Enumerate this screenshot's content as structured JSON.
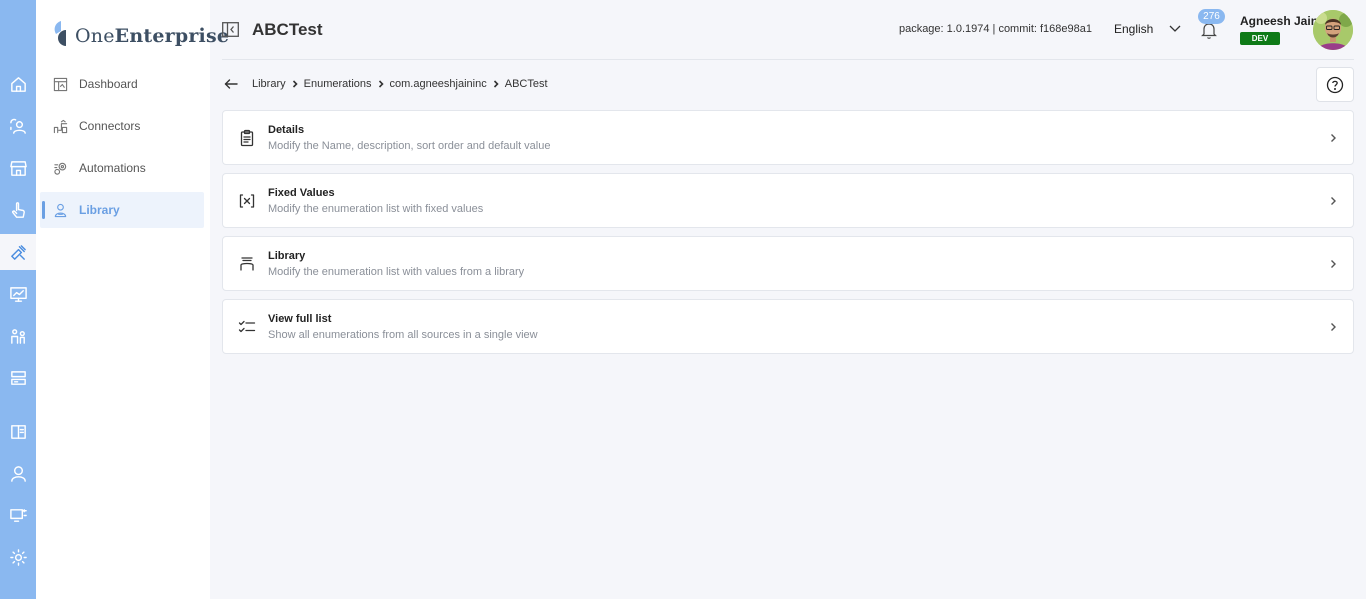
{
  "app": {
    "brand_prefix": "One",
    "brand_suffix": "Enterprise",
    "accent_color": "#8ab8f0",
    "env_color": "#0e7a17"
  },
  "rail": {
    "icons": [
      "home-icon",
      "users-sync-icon",
      "store-icon",
      "touch-icon",
      "tools-icon",
      "monitor-chart-icon",
      "people-icon",
      "server-icon",
      "book-icon",
      "user-support-icon",
      "desktop-icon",
      "settings-icon"
    ],
    "active": "tools-icon"
  },
  "sidebar": {
    "items": [
      {
        "label": "Dashboard",
        "icon": "dashboard-icon"
      },
      {
        "label": "Connectors",
        "icon": "connectors-icon"
      },
      {
        "label": "Automations",
        "icon": "automations-icon"
      },
      {
        "label": "Library",
        "icon": "library-icon",
        "active": true
      }
    ]
  },
  "header": {
    "title": "ABCTest",
    "package_info": "package: 1.0.1974 | commit: f168e98a1",
    "language": "English",
    "notification_count": "276",
    "user_name": "Agneesh Jain",
    "env_badge": "DEV"
  },
  "breadcrumb": [
    "Library",
    "Enumerations",
    "com.agneeshjaininc",
    "ABCTest"
  ],
  "cards": [
    {
      "title": "Details",
      "desc": "Modify the Name, description, sort order and default value",
      "icon": "clipboard-icon"
    },
    {
      "title": "Fixed Values",
      "desc": "Modify the enumeration list with fixed values",
      "icon": "variable-icon"
    },
    {
      "title": "Library",
      "desc": "Modify the enumeration list with values from a library",
      "icon": "library-list-icon"
    },
    {
      "title": "View full list",
      "desc": "Show all enumerations from all sources in a single view",
      "icon": "checklist-icon"
    }
  ]
}
